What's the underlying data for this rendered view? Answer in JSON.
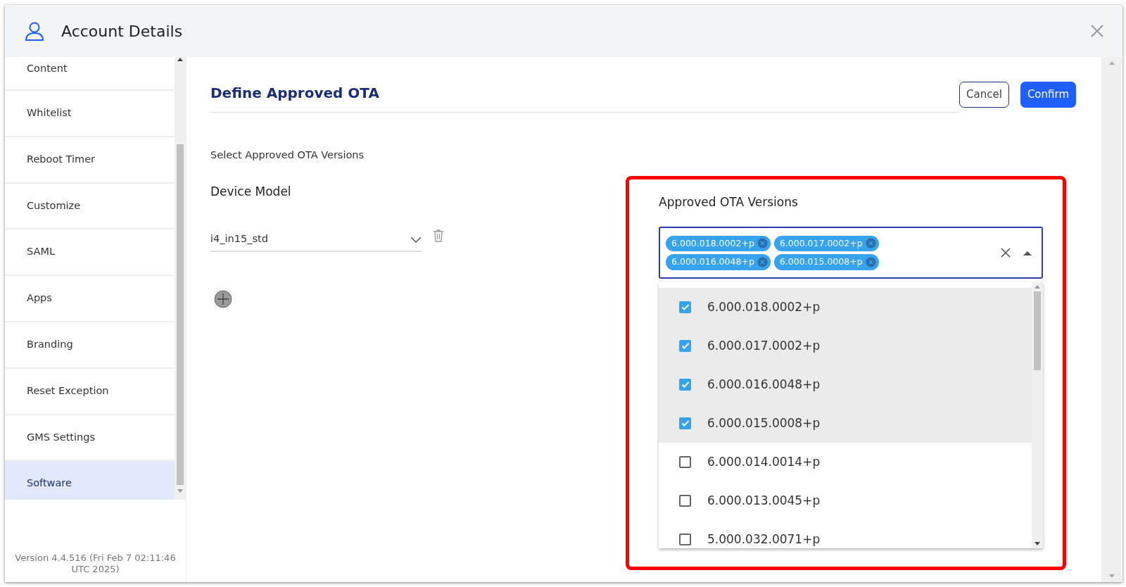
{
  "window": {
    "title": "Account Details"
  },
  "sidebar": {
    "items": [
      {
        "label": "Content",
        "selected": false
      },
      {
        "label": "Whitelist",
        "selected": false
      },
      {
        "label": "Reboot Timer",
        "selected": false
      },
      {
        "label": "Customize",
        "selected": false
      },
      {
        "label": "SAML",
        "selected": false
      },
      {
        "label": "Apps",
        "selected": false
      },
      {
        "label": "Branding",
        "selected": false
      },
      {
        "label": "Reset Exception",
        "selected": false
      },
      {
        "label": "GMS Settings",
        "selected": false
      },
      {
        "label": "Software",
        "selected": true
      }
    ],
    "version": "Version 4.4.516 (Fri Feb 7 02:11:46 UTC 2025)"
  },
  "main": {
    "title": "Define Approved OTA",
    "buttons": {
      "cancel": "Cancel",
      "confirm": "Confirm"
    },
    "subtitle": "Select Approved OTA Versions",
    "device_model": {
      "label": "Device Model",
      "value": "i4_in15_std"
    },
    "approved": {
      "label": "Approved OTA Versions",
      "chips": [
        "6.000.018.0002+p",
        "6.000.017.0002+p",
        "6.000.016.0048+p",
        "6.000.015.0008+p"
      ],
      "options": [
        {
          "label": "6.000.018.0002+p",
          "checked": true
        },
        {
          "label": "6.000.017.0002+p",
          "checked": true
        },
        {
          "label": "6.000.016.0048+p",
          "checked": true
        },
        {
          "label": "6.000.015.0008+p",
          "checked": true
        },
        {
          "label": "6.000.014.0014+p",
          "checked": false
        },
        {
          "label": "6.000.013.0045+p",
          "checked": false
        },
        {
          "label": "5.000.032.0071+p",
          "checked": false
        }
      ]
    }
  }
}
